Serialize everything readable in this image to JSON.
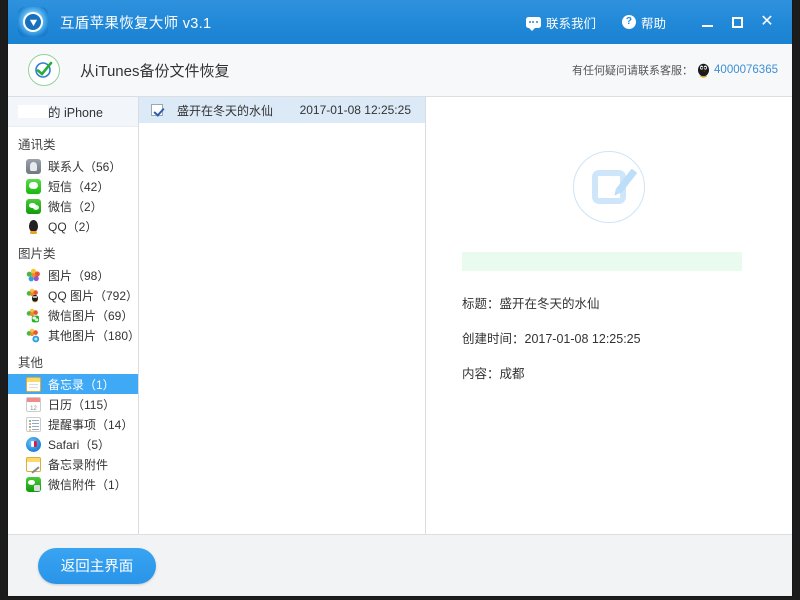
{
  "titlebar": {
    "app_title": "互盾苹果恢复大师 v3.1",
    "logo_icon": "shield-logo-icon",
    "contact_label": "联系我们",
    "contact_icon": "chat-bubble-icon",
    "help_label": "帮助",
    "help_icon": "question-circle-icon",
    "minimize_icon": "minimize-icon",
    "maximize_icon": "maximize-icon",
    "close_icon": "close-icon",
    "bg_color": "#2289d8"
  },
  "subheader": {
    "badge_icon": "green-check-circle-icon",
    "page_title": "从iTunes备份文件恢复",
    "support_text": "有任何疑问请联系客服：",
    "support_icon": "qq-penguin-icon",
    "support_phone": "4000076365",
    "phone_color": "#3d8fd4"
  },
  "sidebar": {
    "device_name": "的 iPhone",
    "device_redacted": true,
    "groups": [
      {
        "label": "通讯类",
        "items": [
          {
            "label": "联系人（56）",
            "icon": "contacts-icon",
            "icon_class": "ic-contacts",
            "active": false
          },
          {
            "label": "短信（42）",
            "icon": "sms-icon",
            "icon_class": "ic-sms",
            "active": false
          },
          {
            "label": "微信（2）",
            "icon": "wechat-icon",
            "icon_class": "ic-wechat",
            "active": false
          },
          {
            "label": "QQ（2）",
            "icon": "qq-icon",
            "icon_class": "ic-qq",
            "active": false
          }
        ]
      },
      {
        "label": "图片类",
        "items": [
          {
            "label": "图片（98）",
            "icon": "photos-icon",
            "icon_class": "ic-pic",
            "active": false
          },
          {
            "label": "QQ 图片（792）",
            "icon": "qq-photos-icon",
            "icon_class": "ic-pic",
            "active": false
          },
          {
            "label": "微信图片（69）",
            "icon": "wechat-photos-icon",
            "icon_class": "ic-pic",
            "active": false
          },
          {
            "label": "其他图片（180）",
            "icon": "other-photos-icon",
            "icon_class": "ic-pic",
            "active": false
          }
        ]
      },
      {
        "label": "其他",
        "items": [
          {
            "label": "备忘录（1）",
            "icon": "notes-icon",
            "icon_class": "ic-notes",
            "active": true
          },
          {
            "label": "日历（115）",
            "icon": "calendar-icon",
            "icon_class": "ic-cal",
            "active": false
          },
          {
            "label": "提醒事项（14）",
            "icon": "reminders-icon",
            "icon_class": "ic-remind",
            "active": false
          },
          {
            "label": "Safari（5）",
            "icon": "safari-icon",
            "icon_class": "ic-safari",
            "active": false
          },
          {
            "label": "备忘录附件",
            "icon": "notes-attachment-icon",
            "icon_class": "ic-notes-att",
            "active": false
          },
          {
            "label": "微信附件（1）",
            "icon": "wechat-attachment-icon",
            "icon_class": "ic-wx-att",
            "active": false
          }
        ]
      }
    ]
  },
  "list": {
    "rows": [
      {
        "checked": true,
        "title": "盛开在冬天的水仙",
        "date": "2017-01-08 12:25:25",
        "selected": true
      }
    ]
  },
  "detail": {
    "preview_icon": "note-edit-icon",
    "highlight_bar_color": "#e8fbee",
    "fields": [
      "标题：盛开在冬天的水仙",
      "创建时间：2017-01-08 12:25:25",
      "内容：成都"
    ]
  },
  "footer": {
    "back_label": "返回主界面",
    "back_color": "#2f9ced"
  }
}
